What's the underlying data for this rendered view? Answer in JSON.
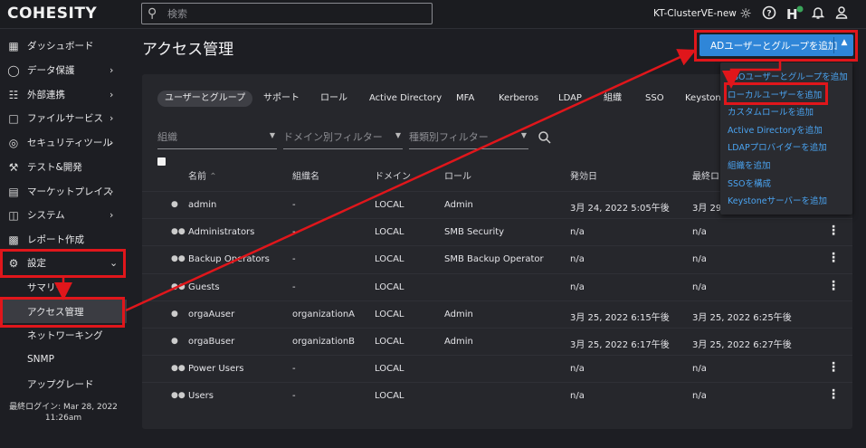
{
  "topbar": {
    "logo": "COHESITY",
    "search_placeholder": "検索",
    "cluster_name": "KT-ClusterVE-new",
    "icons": [
      "sun-icon",
      "help-icon",
      "h-logo-icon",
      "bell-icon",
      "user-icon"
    ]
  },
  "sidebar": {
    "items": [
      {
        "label": "ダッシュボード",
        "icon": "dashboard-icon",
        "chevron": false
      },
      {
        "label": "データ保護",
        "icon": "shield-icon",
        "chevron": true
      },
      {
        "label": "外部連携",
        "icon": "network-icon",
        "chevron": true
      },
      {
        "label": "ファイルサービス",
        "icon": "folder-icon",
        "chevron": true
      },
      {
        "label": "セキュリティツール",
        "icon": "fingerprint-icon",
        "chevron": true
      },
      {
        "label": "テスト&開発",
        "icon": "wrench-icon",
        "chevron": false
      },
      {
        "label": "マーケットプレイス",
        "icon": "store-icon",
        "chevron": true
      },
      {
        "label": "システム",
        "icon": "system-icon",
        "chevron": true
      },
      {
        "label": "レポート作成",
        "icon": "report-icon",
        "chevron": false
      },
      {
        "label": "設定",
        "icon": "gear-icon",
        "chevron": true
      }
    ],
    "sub_items": [
      {
        "label": "サマリー"
      },
      {
        "label": "アクセス管理"
      },
      {
        "label": "ネットワーキング"
      },
      {
        "label": "SNMP"
      },
      {
        "label": "アップグレード"
      }
    ],
    "last_login_line1": "最終ログイン: Mar 28, 2022",
    "last_login_line2": "11:26am"
  },
  "main": {
    "title": "アクセス管理",
    "add_button_label": "ADユーザーとグループを追加",
    "tabs": [
      "ユーザーとグループ",
      "サポート",
      "ロール",
      "Active Directory",
      "MFA",
      "Kerberos",
      "LDAP",
      "組織",
      "SSO",
      "Keystone"
    ],
    "filters": {
      "org": "組織",
      "domain": "ドメイン別フィルター",
      "type": "種類別フィルター"
    },
    "columns": [
      "名前",
      "組織名",
      "ドメイン",
      "ロール",
      "発効日",
      "最終ロ"
    ],
    "rows": [
      {
        "type": "user",
        "name": "admin",
        "org": "-",
        "domain": "LOCAL",
        "role": "Admin",
        "effective": "3月 24, 2022 5:05午後",
        "last": "3月 29,",
        "kebab": false
      },
      {
        "type": "group",
        "name": "Administrators",
        "org": "-",
        "domain": "LOCAL",
        "role": "SMB Security",
        "effective": "n/a",
        "last": "n/a",
        "kebab": true
      },
      {
        "type": "group",
        "name": "Backup Operators",
        "org": "-",
        "domain": "LOCAL",
        "role": "SMB Backup Operator",
        "effective": "n/a",
        "last": "n/a",
        "kebab": true
      },
      {
        "type": "group",
        "name": "Guests",
        "org": "-",
        "domain": "LOCAL",
        "role": "",
        "effective": "n/a",
        "last": "n/a",
        "kebab": true
      },
      {
        "type": "user",
        "name": "orgaAuser",
        "org": "organizationA",
        "domain": "LOCAL",
        "role": "Admin",
        "effective": "3月 25, 2022 6:15午後",
        "last": "3月 25, 2022 6:25午後",
        "kebab": false
      },
      {
        "type": "user",
        "name": "orgaBuser",
        "org": "organizationB",
        "domain": "LOCAL",
        "role": "Admin",
        "effective": "3月 25, 2022 6:17午後",
        "last": "3月 25, 2022 6:27午後",
        "kebab": false
      },
      {
        "type": "group",
        "name": "Power Users",
        "org": "-",
        "domain": "LOCAL",
        "role": "",
        "effective": "n/a",
        "last": "n/a",
        "kebab": true
      },
      {
        "type": "group",
        "name": "Users",
        "org": "-",
        "domain": "LOCAL",
        "role": "",
        "effective": "n/a",
        "last": "n/a",
        "kebab": true
      }
    ]
  },
  "dropdown_menu": {
    "items": [
      "SSOユーザーとグループを追加",
      "ローカルユーザーを追加",
      "カスタムロールを追加",
      "Active Directoryを追加",
      "LDAPプロバイダーを追加",
      "組織を追加",
      "SSOを構成",
      "Keystoneサーバーを追加"
    ],
    "link_color": "#4aa3f0"
  },
  "colors": {
    "accent": "#2f86d8",
    "annotation": "#e0161b",
    "background": "#1d1e23",
    "panel": "#26272c"
  }
}
